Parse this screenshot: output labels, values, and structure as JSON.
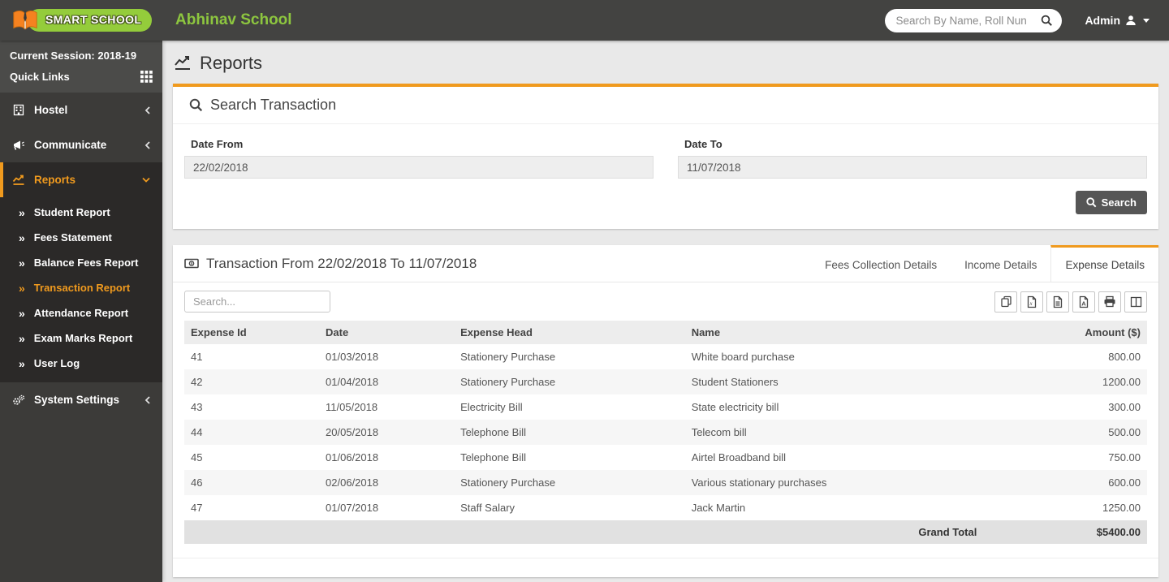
{
  "colors": {
    "accent": "#F09A1E",
    "brand_green": "#8DC63F",
    "header_bg": "#434341",
    "sidebar_bg": "#3C3B39",
    "session_bg": "#4B4B49",
    "active_item_bg": "#2B2928",
    "page_bg": "#E9E9E9"
  },
  "header": {
    "logo_text": "SMART SCHOOL",
    "school_name": "Abhinav School",
    "search_placeholder": "Search By Name, Roll Nun",
    "user_label": "Admin"
  },
  "sidebar": {
    "session_label": "Current Session: 2018-19",
    "quick_links_label": "Quick Links",
    "menu": [
      {
        "label": "Hostel",
        "icon": "building-icon",
        "chevron": "left",
        "active": false
      },
      {
        "label": "Communicate",
        "icon": "megaphone-icon",
        "chevron": "left",
        "active": false
      },
      {
        "label": "Reports",
        "icon": "chart-line-icon",
        "chevron": "down",
        "active": true,
        "submenu": [
          {
            "label": "Student Report",
            "active": false
          },
          {
            "label": "Fees Statement",
            "active": false
          },
          {
            "label": "Balance Fees Report",
            "active": false
          },
          {
            "label": "Transaction Report",
            "active": true
          },
          {
            "label": "Attendance Report",
            "active": false
          },
          {
            "label": "Exam Marks Report",
            "active": false
          },
          {
            "label": "User Log",
            "active": false
          }
        ]
      },
      {
        "label": "System Settings",
        "icon": "gears-icon",
        "chevron": "left",
        "active": false
      }
    ]
  },
  "main": {
    "page_title": "Reports",
    "search_panel": {
      "title": "Search Transaction",
      "date_from_label": "Date From",
      "date_from_value": "22/02/2018",
      "date_to_label": "Date To",
      "date_to_value": "11/07/2018",
      "search_button_label": "Search"
    },
    "transaction_panel": {
      "title": "Transaction From 22/02/2018 To 11/07/2018",
      "tabs": [
        {
          "label": "Fees Collection Details",
          "active": false
        },
        {
          "label": "Income Details",
          "active": false
        },
        {
          "label": "Expense Details",
          "active": true
        }
      ],
      "table_search_placeholder": "Search...",
      "export_buttons": [
        "copy",
        "excel",
        "csv",
        "pdf",
        "print",
        "columns"
      ],
      "table": {
        "headers": [
          "Expense Id",
          "Date",
          "Expense Head",
          "Name",
          "Amount ($)"
        ],
        "rows": [
          [
            "41",
            "01/03/2018",
            "Stationery Purchase",
            "White board purchase",
            "800.00"
          ],
          [
            "42",
            "01/04/2018",
            "Stationery Purchase",
            "Student Stationers",
            "1200.00"
          ],
          [
            "43",
            "11/05/2018",
            "Electricity Bill",
            "State electricity bill",
            "300.00"
          ],
          [
            "44",
            "20/05/2018",
            "Telephone Bill",
            "Telecom bill",
            "500.00"
          ],
          [
            "45",
            "01/06/2018",
            "Telephone Bill",
            "Airtel Broadband bill",
            "750.00"
          ],
          [
            "46",
            "02/06/2018",
            "Stationery Purchase",
            "Various stationary purchases",
            "600.00"
          ],
          [
            "47",
            "01/07/2018",
            "Staff Salary",
            "Jack Martin",
            "1250.00"
          ]
        ],
        "grand_total_label": "Grand Total",
        "grand_total_value": "$5400.00"
      }
    }
  }
}
